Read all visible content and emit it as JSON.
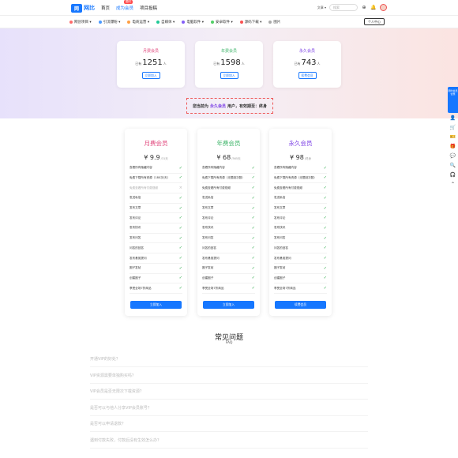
{
  "logo": {
    "mark": "网",
    "text": "网比"
  },
  "topnav": [
    {
      "label": "首页"
    },
    {
      "label": "成为会员",
      "badge": "限时"
    },
    {
      "label": "项目投稿"
    }
  ],
  "search": {
    "select": "文章 ▾",
    "placeholder": "搜索"
  },
  "categories": [
    {
      "label": "网创项目 ▾",
      "color": "#ff6b6b"
    },
    {
      "label": "引流爆粉 ▾",
      "color": "#4c9bff"
    },
    {
      "label": "电商运营 ▾",
      "color": "#ff9f43"
    },
    {
      "label": "自媒体 ▾",
      "color": "#20c997"
    },
    {
      "label": "电脑软件 ▾",
      "color": "#845ef7"
    },
    {
      "label": "安卓软件 ▾",
      "color": "#51cf66"
    },
    {
      "label": "源码下载 ▾",
      "color": "#fa5252"
    },
    {
      "label": "图片",
      "color": "#aaaaaa"
    }
  ],
  "center_button": "个人中心",
  "membership_cards": [
    {
      "title": "月费会员",
      "color": "#e0457b",
      "prefix": "已有",
      "count": "1251",
      "suffix": "人",
      "button": "立即加入"
    },
    {
      "title": "年费会员",
      "color": "#3fb56a",
      "prefix": "已有",
      "count": "1598",
      "suffix": "人",
      "button": "立即加入"
    },
    {
      "title": "永久会员",
      "color": "#7b3fe4",
      "prefix": "已有",
      "count": "743",
      "suffix": "人",
      "button": "续费会员"
    }
  ],
  "notice": {
    "before": "您当前为",
    "vip": "永久会员",
    "after": "用户，有效期至：终身"
  },
  "price_cards": [
    {
      "title": "月费会员",
      "color": "#e0457b",
      "price": "¥ 9.9",
      "period": "/31天",
      "button": "立即加入",
      "features": [
        {
          "label": "查看所有隐藏内容",
          "on": true
        },
        {
          "label": "免费下载所有资源（180次/天）",
          "on": true
        },
        {
          "label": "免费查看所有付费视频",
          "on": false
        },
        {
          "label": "发送私信",
          "on": true
        },
        {
          "label": "发布文章",
          "on": true
        },
        {
          "label": "发布评论",
          "on": true
        },
        {
          "label": "发布快讯",
          "on": true
        },
        {
          "label": "发布问答",
          "on": true
        },
        {
          "label": "问答的回答",
          "on": true
        },
        {
          "label": "发布悬赏提问",
          "on": true
        },
        {
          "label": "圈子发帖",
          "on": true
        },
        {
          "label": "创建圈子",
          "on": true
        },
        {
          "label": "享受全场7折商品",
          "on": true
        }
      ]
    },
    {
      "title": "年费会员",
      "color": "#3fb56a",
      "price": "¥ 68",
      "period": "/365天",
      "button": "立即加入",
      "features": [
        {
          "label": "查看所有隐藏内容",
          "on": true
        },
        {
          "label": "免费下载所有资源（无限制次数）",
          "on": true
        },
        {
          "label": "免费查看所有付费视频",
          "on": true
        },
        {
          "label": "发送私信",
          "on": true
        },
        {
          "label": "发布文章",
          "on": true
        },
        {
          "label": "发布评论",
          "on": true
        },
        {
          "label": "发布快讯",
          "on": true
        },
        {
          "label": "发布问答",
          "on": true
        },
        {
          "label": "问答的回答",
          "on": true
        },
        {
          "label": "发布悬赏提问",
          "on": true
        },
        {
          "label": "圈子发帖",
          "on": true
        },
        {
          "label": "创建圈子",
          "on": true
        },
        {
          "label": "享受全场7折商品",
          "on": true
        }
      ]
    },
    {
      "title": "永久会员",
      "color": "#7b3fe4",
      "price": "¥ 98",
      "period": "/终身",
      "button": "续费会员",
      "features": [
        {
          "label": "查看所有隐藏内容",
          "on": true
        },
        {
          "label": "免费下载所有资源（无限制次数）",
          "on": true
        },
        {
          "label": "免费查看所有付费视频",
          "on": true
        },
        {
          "label": "发送私信",
          "on": true
        },
        {
          "label": "发布文章",
          "on": true
        },
        {
          "label": "发布评论",
          "on": true
        },
        {
          "label": "发布快讯",
          "on": true
        },
        {
          "label": "发布问答",
          "on": true
        },
        {
          "label": "问答的回答",
          "on": true
        },
        {
          "label": "发布悬赏提问",
          "on": true
        },
        {
          "label": "圈子发帖",
          "on": true
        },
        {
          "label": "创建圈子",
          "on": true
        },
        {
          "label": "享受全场7折商品",
          "on": true
        }
      ]
    }
  ],
  "faq": {
    "title": "常见问题",
    "subtitle": "FAQ",
    "items": [
      "开通VIP的好处？",
      "VIP资源需要单独购买吗？",
      "VIP会员是否无限次下载资源？",
      "是否可以与他人分享VIP会员账号？",
      "是否可以申请退款？",
      "遇到付款失败，付款后没有生效怎么办？"
    ]
  },
  "sidebar": {
    "blue_label": "限时会员优惠",
    "icons": [
      "user-icon",
      "cart-icon",
      "coupon-icon",
      "gift-icon",
      "chat-icon",
      "search-icon",
      "headset-icon",
      "top-icon"
    ]
  }
}
